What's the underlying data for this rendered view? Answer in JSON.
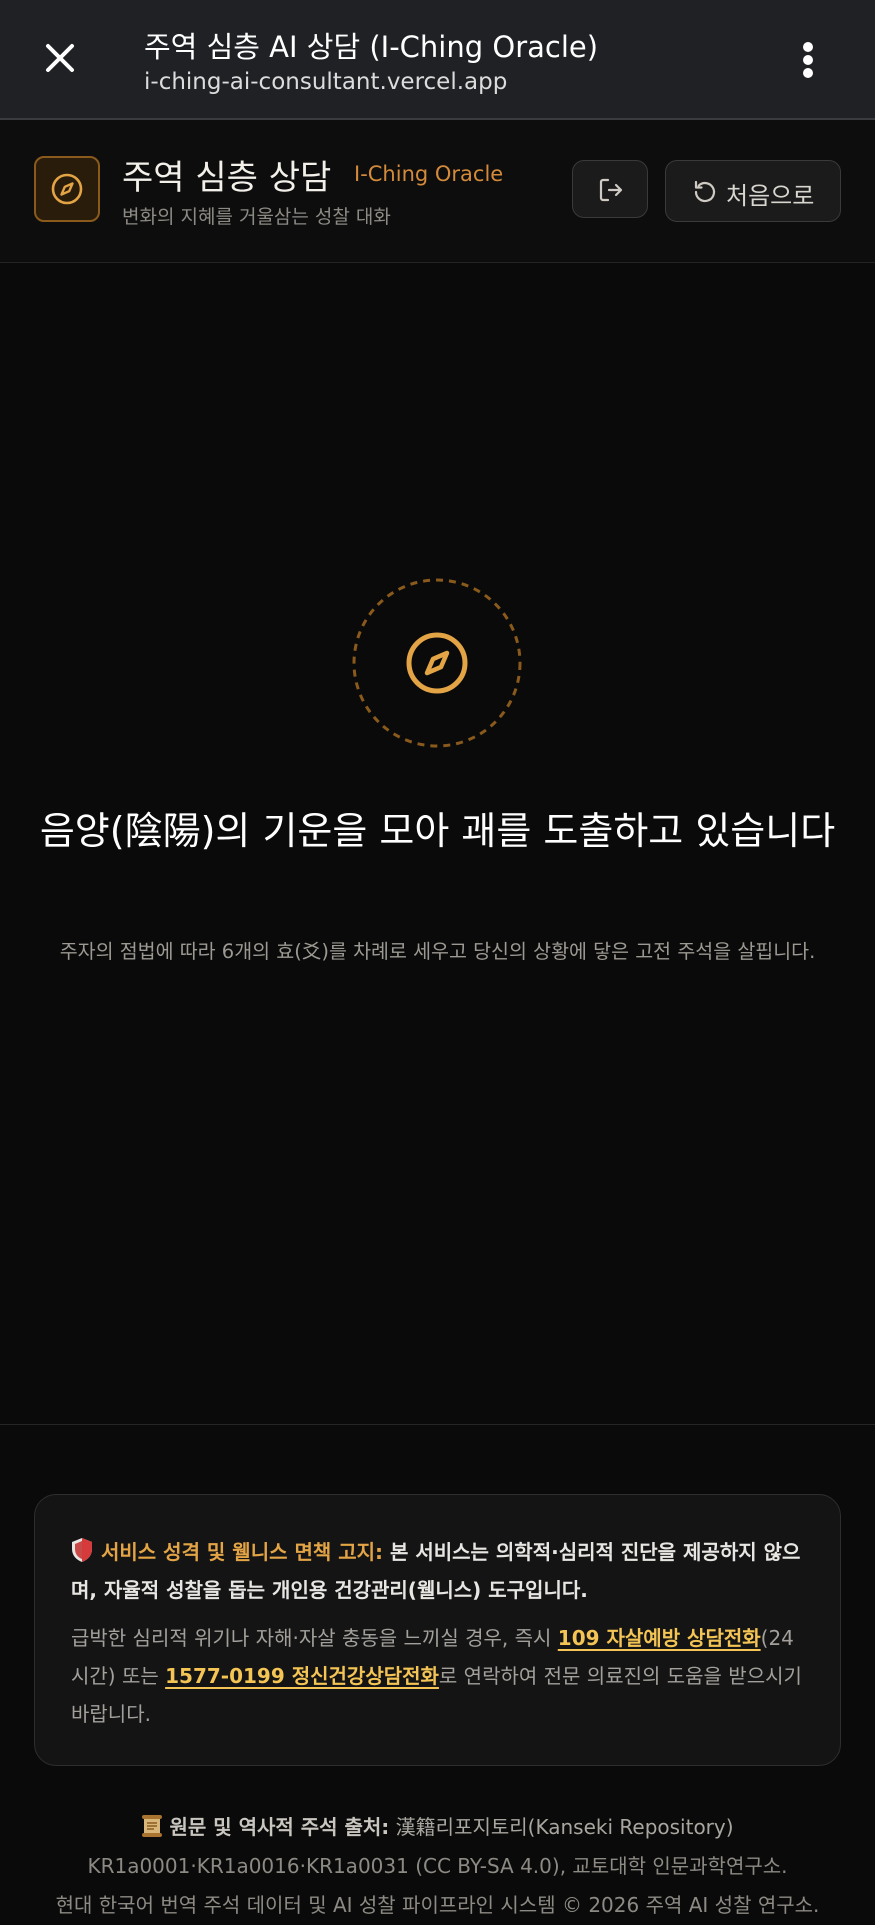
{
  "browser": {
    "title": "주역 심층 AI 상담 (I-Ching Oracle)",
    "url": "i-ching-ai-consultant.vercel.app",
    "close_icon": "close-icon",
    "menu_icon": "more-vert-icon"
  },
  "header": {
    "logo_icon": "compass-icon",
    "title": "주역 심층 상담",
    "title_en": "I-Ching Oracle",
    "subtitle": "변화의 지혜를 거울삼는 성찰 대화",
    "exit_icon": "logout-icon",
    "restart_icon": "rotate-ccw-icon",
    "restart_label": "처음으로"
  },
  "loading": {
    "icon": "compass-icon",
    "title": "음양(陰陽)의 기운을 모아 괘를 도출하고 있습니다",
    "description": "주자의 점법에 따라 6개의 효(爻)를 차례로 세우고 당신의 상황에 닿은 고전 주석을 살핍니다."
  },
  "disclaimer": {
    "icon": "shield-icon",
    "heading_label": "서비스 성격 및 웰니스 면책 고지:",
    "heading_text": " 본 서비스는 의학적·심리적 진단을 제공하지 않으며, 자율적 성찰을 돕는 개인용 건강관리(웰니스) 도구입니다.",
    "body_prefix": "급박한 심리적 위기나 자해·자살 충동을 느끼실 경우, 즉시 ",
    "link1": "109 자살예방 상담전화",
    "body_middle": "(24시간) 또는 ",
    "link2": "1577-0199 정신건강상담전화",
    "body_suffix": "로 연락하여 전문 의료진의 도움을 받으시기 바랍니다."
  },
  "sources": {
    "icon": "scroll-icon",
    "label": "원문 및 역사적 주석 출처:",
    "repo": " 漢籍리포지토리(Kanseki Repository)",
    "ids": "KR1a0001·KR1a0016·KR1a0031 (CC BY-SA 4.0), 교토대학 인문과학연구소.",
    "copyright": "현대 한국어 번역 주석 데이터 및 AI 성찰 파이프라인 시스템 © 2026 주역 AI 성찰 연구소."
  },
  "colors": {
    "accent": "#e3a446",
    "link": "#f4c454",
    "background": "#0a0a0a"
  }
}
